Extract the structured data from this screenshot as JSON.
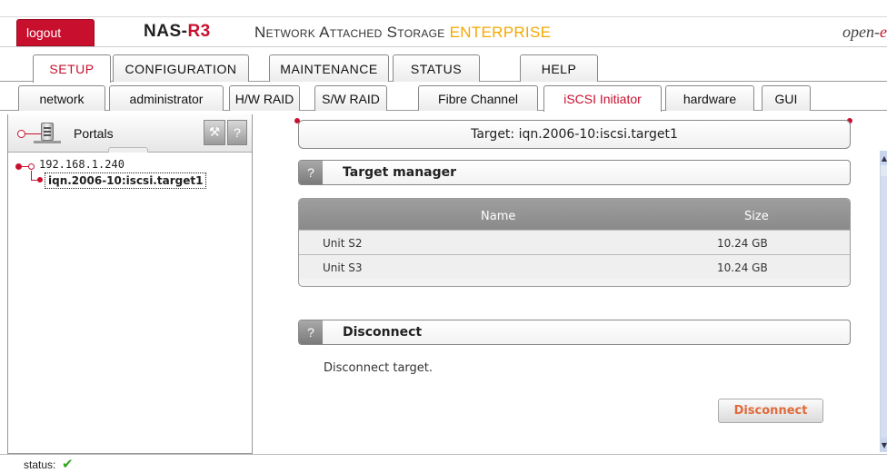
{
  "header": {
    "logout_label": "logout",
    "brand_prefix": "NAS-",
    "brand_suffix": "R3",
    "subtitle": "Network Attached Storage",
    "edition": "ENTERPRISE",
    "vendor_prefix": "open-",
    "vendor_suffix": "e"
  },
  "main_tabs": [
    {
      "label": "SETUP",
      "active": true
    },
    {
      "label": "CONFIGURATION",
      "active": false
    },
    {
      "label": "MAINTENANCE",
      "active": false
    },
    {
      "label": "STATUS",
      "active": false
    },
    {
      "label": "HELP",
      "active": false
    }
  ],
  "sub_tabs": [
    {
      "label": "network",
      "active": false
    },
    {
      "label": "administrator",
      "active": false
    },
    {
      "label": "H/W RAID",
      "active": false
    },
    {
      "label": "S/W RAID",
      "active": false
    },
    {
      "label": "Fibre Channel",
      "active": false
    },
    {
      "label": "iSCSI Initiator",
      "active": true
    },
    {
      "label": "hardware",
      "active": false
    },
    {
      "label": "GUI",
      "active": false
    }
  ],
  "left_panel": {
    "title": "Portals",
    "help_label": "?",
    "tree": {
      "portal_ip": "192.168.1.240",
      "target": "iqn.2006-10:iscsi.target1"
    }
  },
  "content": {
    "target_header": "Target: iqn.2006-10:iscsi.target1",
    "target_manager": {
      "help_label": "?",
      "title": "Target manager",
      "columns": [
        "Name",
        "Size"
      ],
      "rows": [
        {
          "name": "Unit S2",
          "size": "10.24 GB"
        },
        {
          "name": "Unit S3",
          "size": "10.24 GB"
        }
      ]
    },
    "disconnect": {
      "help_label": "?",
      "title": "Disconnect",
      "description": "Disconnect target.",
      "button_label": "Disconnect"
    }
  },
  "status": {
    "label": "status:",
    "check": "✔"
  },
  "colors": {
    "accent": "#c8102e",
    "edition": "#f4a800",
    "button_text": "#e06a3a",
    "status_ok": "#2ea81c"
  }
}
